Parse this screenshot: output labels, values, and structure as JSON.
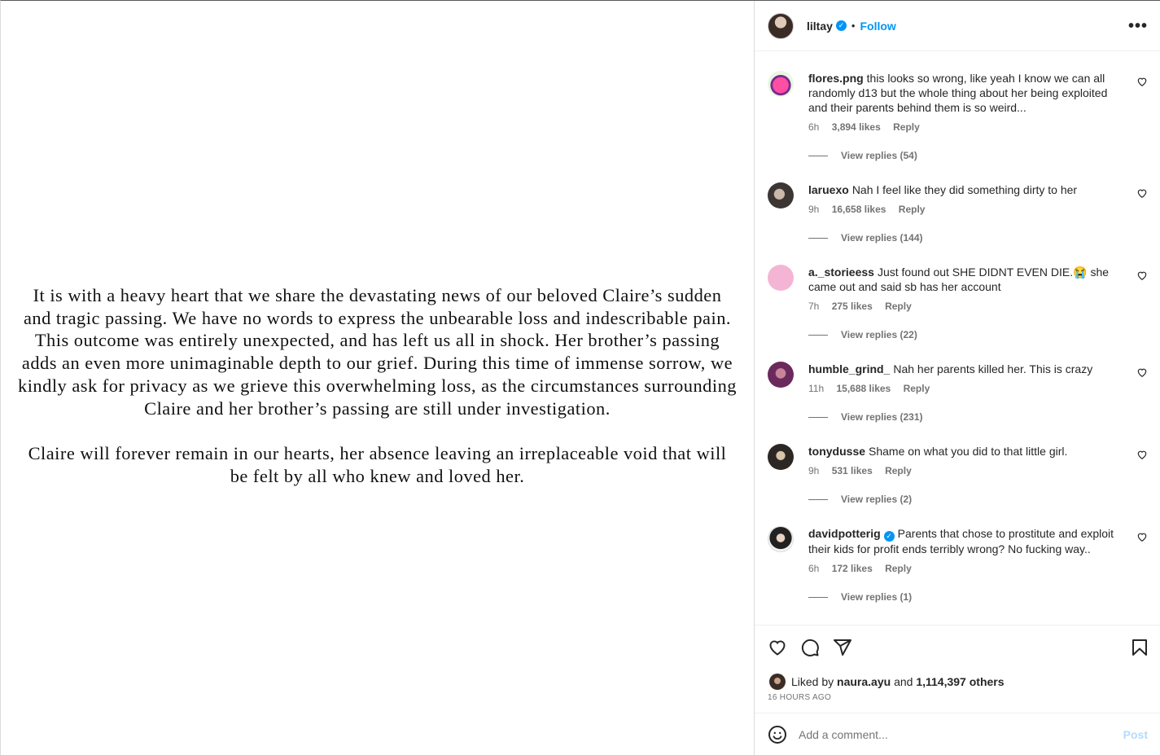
{
  "post": {
    "paragraphs": [
      "It is with a heavy heart that we share the devastating news of our beloved Claire’s sudden and tragic passing. We have no words to express the unbearable loss and indescribable pain. This outcome was entirely unexpected, and has left us all in shock. Her brother’s passing adds an even more unimaginable depth to our grief. During this time of immense sorrow, we kindly ask for privacy as we grieve this overwhelming loss, as the circumstances surrounding Claire and her brother’s passing are still under investigation.",
      "Claire will forever remain in our hearts, her absence leaving an irreplaceable void that will be felt by all who knew and loved her."
    ]
  },
  "header": {
    "username": "liltay",
    "verified_mark": "✓",
    "separator": "•",
    "follow_label": "Follow",
    "more_label": "•••"
  },
  "comments": [
    {
      "user": "flores.png",
      "text": "this looks so wrong, like yeah I know we can all randomly d13 but the whole thing about her being exploited and their parents behind them is so weird...",
      "time": "6h",
      "likes": "3,894 likes",
      "reply": "Reply",
      "view_replies": "View replies (54)",
      "verified": false
    },
    {
      "user": "laruexo",
      "text": "Nah I feel like they did something dirty to her",
      "time": "9h",
      "likes": "16,658 likes",
      "reply": "Reply",
      "view_replies": "View replies (144)",
      "verified": false
    },
    {
      "user": "a._storieess",
      "text": "Just found out SHE DIDNT EVEN DIE.😭 she came out and said sb has her account",
      "time": "7h",
      "likes": "275 likes",
      "reply": "Reply",
      "view_replies": "View replies (22)",
      "verified": false
    },
    {
      "user": "humble_grind_",
      "text": "Nah her parents killed her. This is crazy",
      "time": "11h",
      "likes": "15,688 likes",
      "reply": "Reply",
      "view_replies": "View replies (231)",
      "verified": false
    },
    {
      "user": "tonydusse",
      "text": "Shame on what you did to that little girl.",
      "time": "9h",
      "likes": "531 likes",
      "reply": "Reply",
      "view_replies": "View replies (2)",
      "verified": false
    },
    {
      "user": "davidpotterig",
      "text": "Parents that chose to prostitute and exploit their kids for profit ends terribly wrong? No fucking way..",
      "time": "6h",
      "likes": "172 likes",
      "reply": "Reply",
      "view_replies": "View replies (1)",
      "verified": true
    }
  ],
  "likes": {
    "prefix": "Liked by",
    "user": "naura.ayu",
    "middle": "and",
    "count": "1,114,397 others"
  },
  "timestamp": "16 HOURS AGO",
  "composer": {
    "placeholder": "Add a comment...",
    "post_label": "Post"
  },
  "colors": {
    "accent": "#0095f6",
    "post_disabled": "#b3dbff",
    "muted": "#737373"
  },
  "icons": [
    "heart-icon",
    "comment-icon",
    "share-icon",
    "bookmark-icon",
    "emoji-icon",
    "more-icon",
    "verified-icon"
  ]
}
